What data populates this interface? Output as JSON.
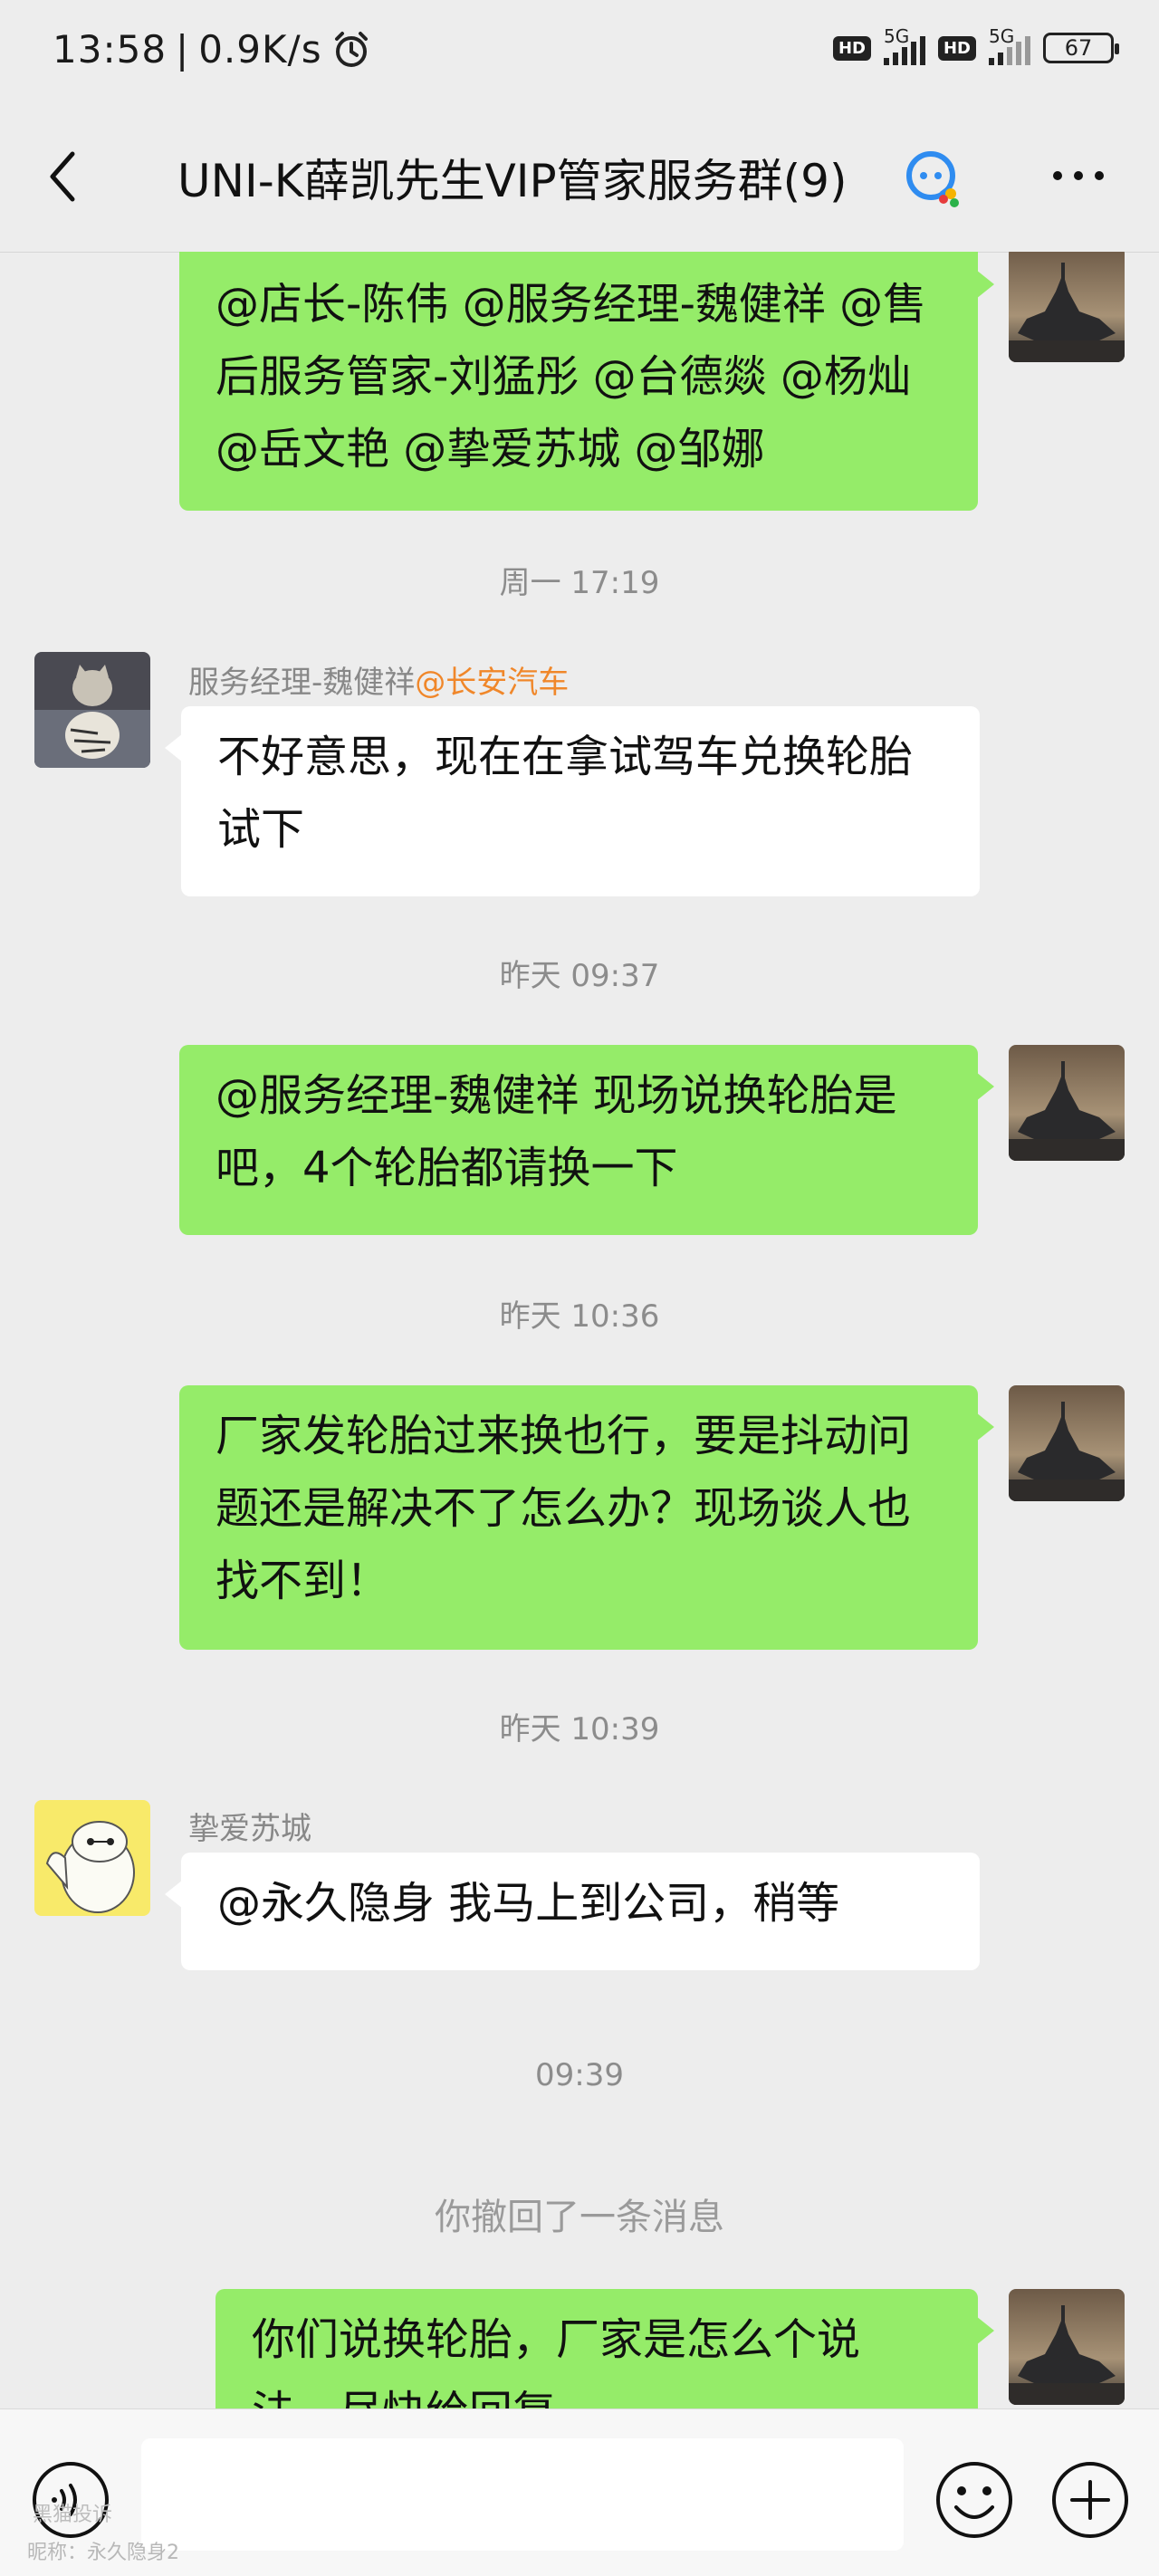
{
  "status_bar": {
    "time": "13:58",
    "speed": "0.9K/s",
    "hd1": "HD",
    "net1": "5G",
    "hd2": "HD",
    "net2": "5G",
    "battery": "67"
  },
  "header": {
    "title": "UNI-K薛凯先生VIP管家服务群(9)"
  },
  "messages": {
    "m1_text": "@店长-陈伟 @服务经理-魏健祥 @售后服务管家-刘猛彤 @台德燚 @杨灿 @岳文艳 @挚爱苏城 @邹娜",
    "ts1": "周一 17:19",
    "m2_sender": "服务经理-魏健祥",
    "m2_tag": "@长安汽车",
    "m2_text": "不好意思，现在在拿试驾车兑换轮胎试下",
    "ts2": "昨天 09:37",
    "m3_text": "@服务经理-魏健祥  现场说换轮胎是吧，4个轮胎都请换一下",
    "ts3": "昨天 10:36",
    "m4_text": "厂家发轮胎过来换也行，要是抖动问题还是解决不了怎么办？现场谈人也找不到！",
    "ts4": "昨天 10:39",
    "m5_sender": "挚爱苏城",
    "m5_text": "@永久隐身  我马上到公司，稍等",
    "ts5": "09:39",
    "recall": "你撤回了一条消息",
    "m6_text": "你们说换轮胎，厂家是怎么个说法，尽快给回复"
  },
  "input": {
    "placeholder": "",
    "watermark_top": "黑猫投诉",
    "watermark": "昵称：永久隐身2"
  },
  "icons": {
    "back": "back-icon",
    "group": "enterprise-group-icon",
    "more": "more-icon",
    "voice": "voice-icon",
    "emoji": "emoji-icon",
    "plus": "plus-icon"
  },
  "colors": {
    "bubble_self": "#95ec69",
    "bubble_other": "#ffffff",
    "background": "#ededed",
    "tag": "#f0872a"
  }
}
